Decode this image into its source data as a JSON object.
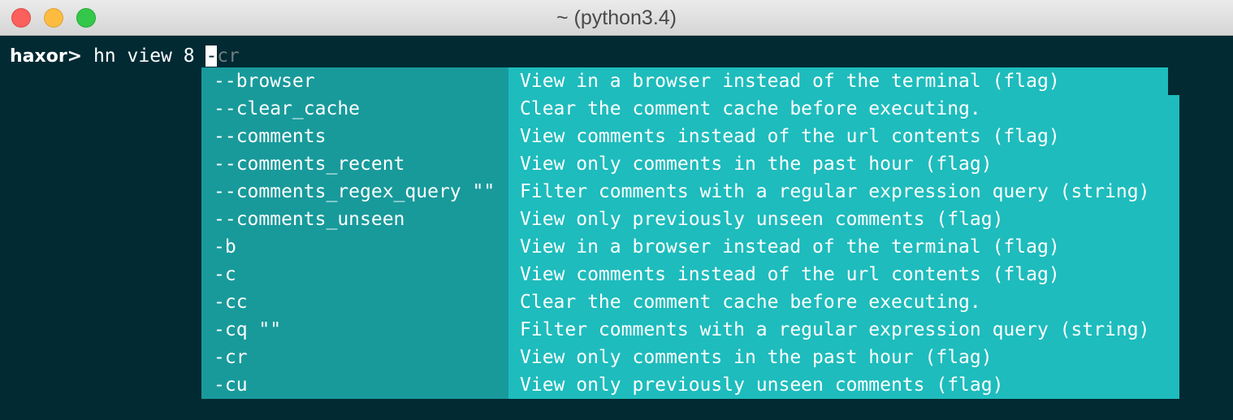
{
  "window": {
    "title": "~ (python3.4)"
  },
  "prompt": {
    "label": "haxor>",
    "command": " hn view 8 ",
    "cursor_char": "-",
    "suggestion": "cr"
  },
  "completion_menu": {
    "items": [
      {
        "option": "--browser",
        "description": "View in a browser instead of the terminal (flag)"
      },
      {
        "option": "--clear_cache",
        "description": "Clear the comment cache before executing."
      },
      {
        "option": "--comments",
        "description": "View comments instead of the url contents (flag)"
      },
      {
        "option": "--comments_recent",
        "description": "View only comments in the past hour (flag)"
      },
      {
        "option": "--comments_regex_query \"\"",
        "description": "Filter comments with a regular expression query (string)"
      },
      {
        "option": "--comments_unseen",
        "description": "View only previously unseen comments (flag)"
      },
      {
        "option": "-b",
        "description": "View in a browser instead of the terminal (flag)"
      },
      {
        "option": "-c",
        "description": "View comments instead of the url contents (flag)"
      },
      {
        "option": "-cc",
        "description": "Clear the comment cache before executing."
      },
      {
        "option": "-cq \"\"",
        "description": "Filter comments with a regular expression query (string)"
      },
      {
        "option": "-cr",
        "description": "View only comments in the past hour (flag)"
      },
      {
        "option": "-cu",
        "description": "View only previously unseen comments (flag)"
      }
    ]
  },
  "colors": {
    "terminal_bg": "#022a33",
    "menu_option_bg": "#189a9b",
    "menu_description_bg": "#1ebcbd",
    "text": "#ffffff",
    "suggestion_text": "#707d80"
  }
}
